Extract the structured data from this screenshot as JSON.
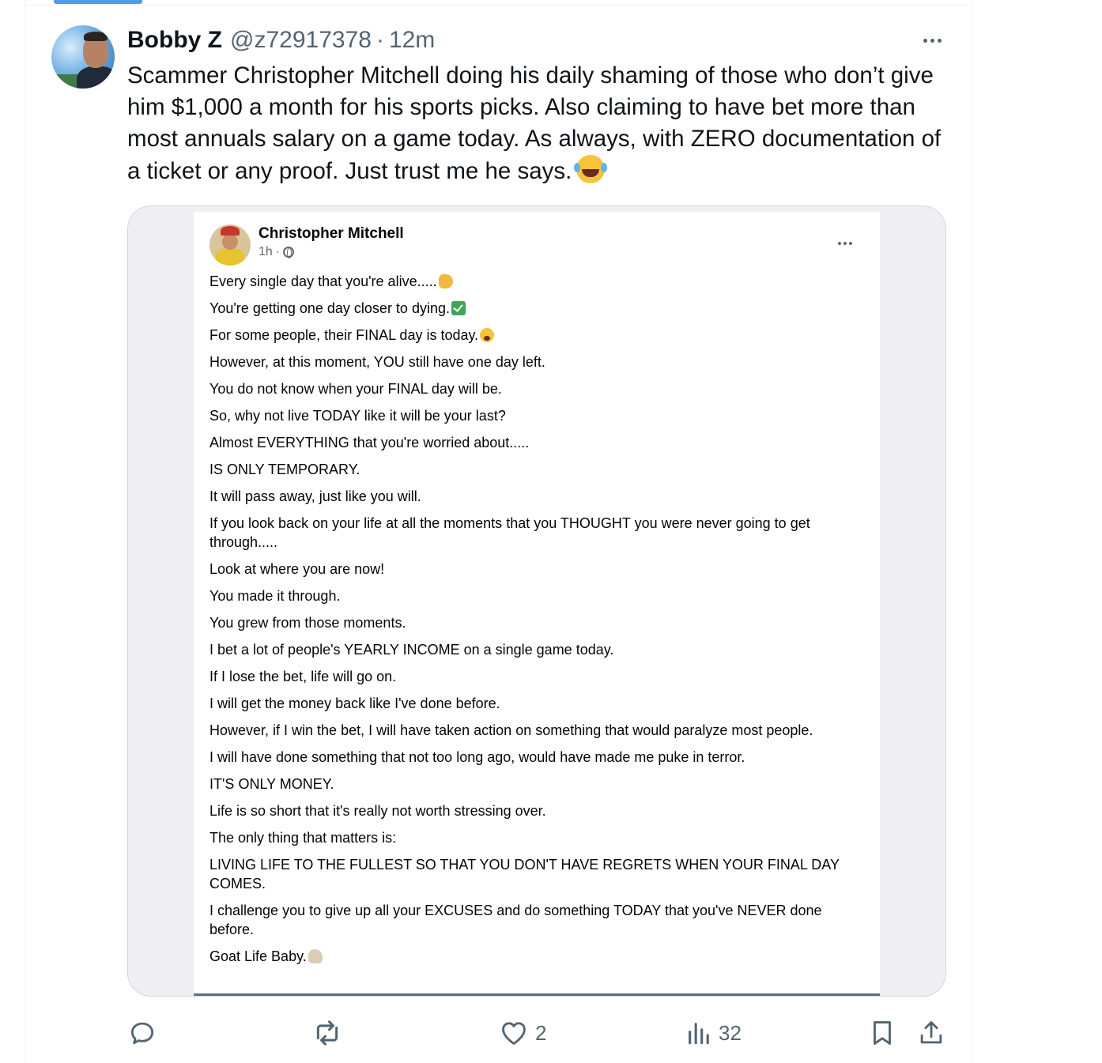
{
  "tweet": {
    "display_name": "Bobby Z",
    "handle": "@z72917378",
    "separator": "·",
    "time": "12m",
    "text": "Scammer Christopher Mitchell doing his daily shaming of those who don’t give him $1,000 a month for his sports picks. Also claiming to have bet more than most annuals salary on a game today. As always, with ZERO documentation of a ticket or any proof. Just trust me he says.",
    "text_emoji": "face-with-tears-of-joy"
  },
  "embedded_post": {
    "author": "Christopher Mitchell",
    "time": "1h",
    "meta_separator": "·",
    "visibility_icon": "globe-icon",
    "lines": [
      {
        "text": "Every single day that you're alive.....",
        "emoji": "point-down"
      },
      {
        "text": "You're getting one day closer to dying.",
        "emoji": "check-mark"
      },
      {
        "text": "For some people, their FINAL day is today.",
        "emoji": "crying-face"
      },
      {
        "text": "However, at this moment, YOU still have one day left."
      },
      {
        "text": "You do not know when your FINAL day will be."
      },
      {
        "text": "So, why not live TODAY like it will be your last?"
      },
      {
        "text": "Almost EVERYTHING that you're worried about....."
      },
      {
        "text": "IS ONLY TEMPORARY."
      },
      {
        "text": "It will pass away, just like you will."
      },
      {
        "text": "If you look back on your life at all the moments that you THOUGHT you were never going to get through....."
      },
      {
        "text": "Look at where you are now!"
      },
      {
        "text": "You made it through."
      },
      {
        "text": "You grew from those moments."
      },
      {
        "text": "I bet a lot of people's YEARLY INCOME on a single game today."
      },
      {
        "text": "If I lose the bet, life will go on."
      },
      {
        "text": "I will get the money back like I've done before."
      },
      {
        "text": "However, if I win the bet, I will have taken action on something that would paralyze most people."
      },
      {
        "text": "I will have done something that not too long ago, would have made me puke in terror."
      },
      {
        "text": "IT'S ONLY MONEY."
      },
      {
        "text": "Life is so short that it's really not worth stressing over."
      },
      {
        "text": "The only thing that matters is:"
      },
      {
        "text": "LIVING LIFE TO THE FULLEST SO THAT YOU DON'T HAVE REGRETS WHEN YOUR FINAL DAY COMES."
      },
      {
        "text": "I challenge you to give up all your EXCUSES and do something TODAY that you've NEVER done before."
      },
      {
        "text": "Goat Life Baby.",
        "emoji": "goat"
      }
    ]
  },
  "actions": {
    "reply_count": "",
    "repost_count": "",
    "like_count": "2",
    "views_count": "32"
  },
  "icons": {
    "reply": "reply-icon",
    "repost": "repost-icon",
    "like": "like-icon",
    "views": "views-icon",
    "bookmark": "bookmark-icon",
    "share": "share-icon",
    "more": "more-icon"
  },
  "colors": {
    "accent": "#1d9bf0",
    "text_primary": "#0f1419",
    "text_secondary": "#536471",
    "border": "#cfd9de",
    "fb_secondary": "#65676b"
  }
}
